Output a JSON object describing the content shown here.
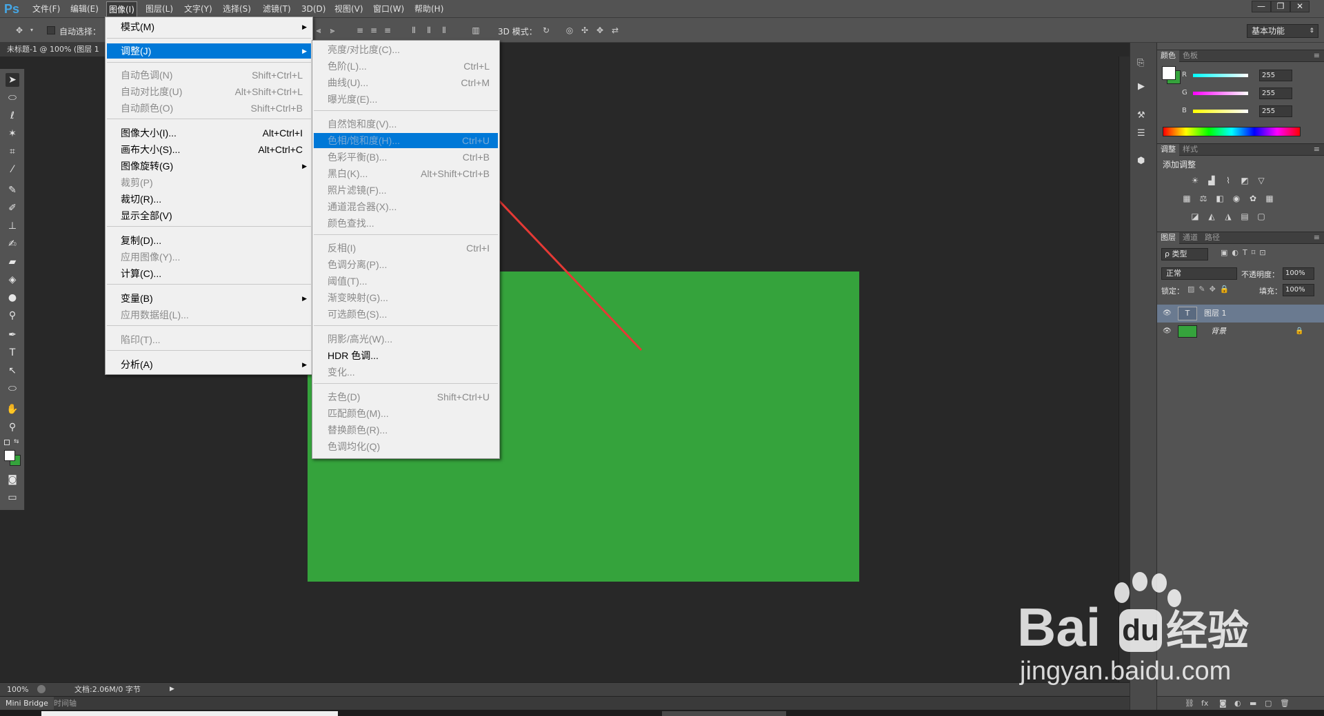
{
  "app": {
    "logo": "Ps",
    "menu": [
      "文件(F)",
      "编辑(E)",
      "图像(I)",
      "图层(L)",
      "文字(Y)",
      "选择(S)",
      "滤镜(T)",
      "3D(D)",
      "视图(V)",
      "窗口(W)",
      "帮助(H)"
    ],
    "active_menu_index": 2,
    "window_buttons": [
      "—",
      "❐",
      "✕"
    ]
  },
  "options": {
    "auto_select_label": "自动选择：",
    "mode3d_label": "3D 模式：",
    "workspace": "基本功能"
  },
  "document": {
    "tab_title": "未标题-1 @ 100% (图层 1",
    "canvas_color": "#35a33c"
  },
  "image_menu": {
    "items": [
      {
        "label": "模式(M)",
        "shortcut": "",
        "submenu": true,
        "disabled": false
      },
      {
        "label": "调整(J)",
        "shortcut": "",
        "submenu": true,
        "disabled": false,
        "highlight": true
      },
      {
        "label": "自动色调(N)",
        "shortcut": "Shift+Ctrl+L",
        "disabled": true
      },
      {
        "label": "自动对比度(U)",
        "shortcut": "Alt+Shift+Ctrl+L",
        "disabled": true
      },
      {
        "label": "自动颜色(O)",
        "shortcut": "Shift+Ctrl+B",
        "disabled": true
      },
      {
        "label": "图像大小(I)...",
        "shortcut": "Alt+Ctrl+I",
        "disabled": false
      },
      {
        "label": "画布大小(S)...",
        "shortcut": "Alt+Ctrl+C",
        "disabled": false
      },
      {
        "label": "图像旋转(G)",
        "shortcut": "",
        "submenu": true,
        "disabled": false
      },
      {
        "label": "裁剪(P)",
        "shortcut": "",
        "disabled": true
      },
      {
        "label": "裁切(R)...",
        "shortcut": "",
        "disabled": false
      },
      {
        "label": "显示全部(V)",
        "shortcut": "",
        "disabled": false
      },
      {
        "label": "复制(D)...",
        "shortcut": "",
        "disabled": false
      },
      {
        "label": "应用图像(Y)...",
        "shortcut": "",
        "disabled": true
      },
      {
        "label": "计算(C)...",
        "shortcut": "",
        "disabled": false
      },
      {
        "label": "变量(B)",
        "shortcut": "",
        "submenu": true,
        "disabled": false
      },
      {
        "label": "应用数据组(L)...",
        "shortcut": "",
        "disabled": true
      },
      {
        "label": "陷印(T)...",
        "shortcut": "",
        "disabled": true
      },
      {
        "label": "分析(A)",
        "shortcut": "",
        "submenu": true,
        "disabled": false
      }
    ]
  },
  "adjust_menu": {
    "items": [
      {
        "label": "亮度/对比度(C)...",
        "shortcut": "",
        "disabled": true
      },
      {
        "label": "色阶(L)...",
        "shortcut": "Ctrl+L",
        "disabled": true
      },
      {
        "label": "曲线(U)...",
        "shortcut": "Ctrl+M",
        "disabled": true
      },
      {
        "label": "曝光度(E)...",
        "shortcut": "",
        "disabled": true
      },
      {
        "label": "自然饱和度(V)...",
        "shortcut": "",
        "disabled": true
      },
      {
        "label": "色相/饱和度(H)...",
        "shortcut": "Ctrl+U",
        "disabled": true,
        "highlight": true
      },
      {
        "label": "色彩平衡(B)...",
        "shortcut": "Ctrl+B",
        "disabled": true
      },
      {
        "label": "黑白(K)...",
        "shortcut": "Alt+Shift+Ctrl+B",
        "disabled": true
      },
      {
        "label": "照片滤镜(F)...",
        "shortcut": "",
        "disabled": true
      },
      {
        "label": "通道混合器(X)...",
        "shortcut": "",
        "disabled": true
      },
      {
        "label": "颜色查找...",
        "shortcut": "",
        "disabled": true
      },
      {
        "label": "反相(I)",
        "shortcut": "Ctrl+I",
        "disabled": true
      },
      {
        "label": "色调分离(P)...",
        "shortcut": "",
        "disabled": true
      },
      {
        "label": "阈值(T)...",
        "shortcut": "",
        "disabled": true
      },
      {
        "label": "渐变映射(G)...",
        "shortcut": "",
        "disabled": true
      },
      {
        "label": "可选颜色(S)...",
        "shortcut": "",
        "disabled": true
      },
      {
        "label": "阴影/高光(W)...",
        "shortcut": "",
        "disabled": true
      },
      {
        "label": "HDR 色调...",
        "shortcut": "",
        "disabled": false
      },
      {
        "label": "变化...",
        "shortcut": "",
        "disabled": true
      },
      {
        "label": "去色(D)",
        "shortcut": "Shift+Ctrl+U",
        "disabled": true
      },
      {
        "label": "匹配颜色(M)...",
        "shortcut": "",
        "disabled": true
      },
      {
        "label": "替换颜色(R)...",
        "shortcut": "",
        "disabled": true
      },
      {
        "label": "色调均化(Q)",
        "shortcut": "",
        "disabled": true
      }
    ]
  },
  "color_panel": {
    "tabs": [
      "颜色",
      "色板"
    ],
    "r_label": "R",
    "g_label": "G",
    "b_label": "B",
    "r": "255",
    "g": "255",
    "b": "255",
    "fg_color": "#ffffff",
    "bg_color": "#35a33c"
  },
  "adjust_panel": {
    "tabs": [
      "调整",
      "样式"
    ],
    "title": "添加调整"
  },
  "layers_panel": {
    "tabs": [
      "图层",
      "通道",
      "路径"
    ],
    "kind_filter": "ρ 类型",
    "blend_mode": "正常",
    "opacity_label": "不透明度：",
    "opacity": "100%",
    "lock_label": "锁定：",
    "fill_label": "填充：",
    "fill": "100%",
    "layers": [
      {
        "name": "图层 1",
        "type": "text",
        "selected": true
      },
      {
        "name": "背景",
        "type": "fill",
        "color": "#35a33c",
        "locked": true
      }
    ]
  },
  "status": {
    "zoom": "100%",
    "doc_info": "文档:2.06M/0 字节"
  },
  "bottom_tabs": [
    "Mini Bridge",
    "时间轴"
  ],
  "watermark": {
    "brand": "Bai",
    "brand_cn": "经验",
    "url": "jingyan.baidu.com"
  }
}
